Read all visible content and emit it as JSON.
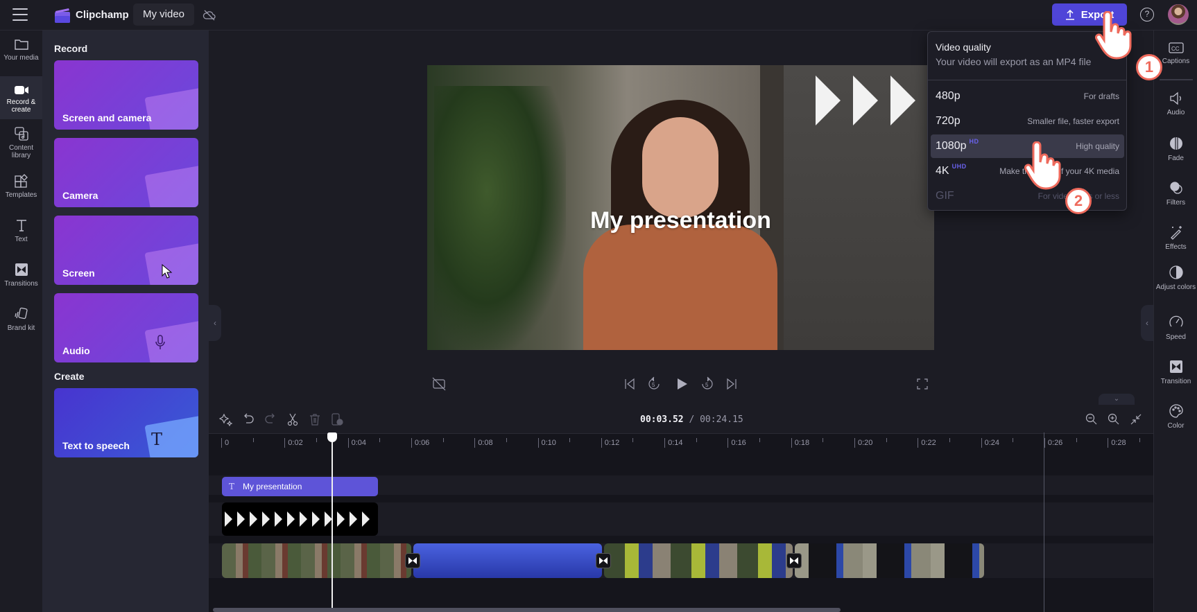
{
  "app": {
    "brand": "Clipchamp",
    "project_name": "My video",
    "export_label": "Export",
    "help_label": "?"
  },
  "colors": {
    "accent": "#4f45d8",
    "annotation": "#ee6a5c",
    "badge": "#6a62ee"
  },
  "left_nav": [
    {
      "label": "Your media",
      "icon": "folder-icon"
    },
    {
      "label": "Record & create",
      "icon": "video-camera-icon",
      "active": true
    },
    {
      "label": "Content library",
      "icon": "content-library-icon"
    },
    {
      "label": "Templates",
      "icon": "templates-icon"
    },
    {
      "label": "Text",
      "icon": "text-icon"
    },
    {
      "label": "Transitions",
      "icon": "transitions-icon"
    },
    {
      "label": "Brand kit",
      "icon": "brand-kit-icon"
    }
  ],
  "panel": {
    "record_heading": "Record",
    "create_heading": "Create",
    "record_cards": [
      {
        "label": "Screen and camera"
      },
      {
        "label": "Camera"
      },
      {
        "label": "Screen"
      },
      {
        "label": "Audio"
      }
    ],
    "create_cards": [
      {
        "label": "Text to speech"
      }
    ]
  },
  "preview": {
    "overlay_title": "My presentation"
  },
  "export_menu": {
    "title": "Video quality",
    "subtitle": "Your video will export as an MP4 file",
    "options": [
      {
        "quality": "480p",
        "badge": "",
        "description": "For drafts",
        "state": "normal"
      },
      {
        "quality": "720p",
        "badge": "",
        "description": "Smaller file, faster export",
        "state": "normal"
      },
      {
        "quality": "1080p",
        "badge": "HD",
        "description": "High quality",
        "state": "hover"
      },
      {
        "quality": "4K",
        "badge": "UHD",
        "description": "Make the most of your 4K media",
        "state": "normal"
      },
      {
        "quality": "GIF",
        "badge": "",
        "description": "For videos 15s or less",
        "state": "disabled"
      }
    ]
  },
  "annotations": {
    "step1": "1",
    "step2": "2"
  },
  "right_nav": [
    {
      "label": "Captions",
      "icon": "captions-icon"
    },
    {
      "label": "Audio",
      "icon": "speaker-icon"
    },
    {
      "label": "Fade",
      "icon": "fade-icon"
    },
    {
      "label": "Filters",
      "icon": "filters-icon"
    },
    {
      "label": "Effects",
      "icon": "magic-wand-icon"
    },
    {
      "label": "Adjust colors",
      "icon": "contrast-icon"
    },
    {
      "label": "Speed",
      "icon": "speedometer-icon"
    },
    {
      "label": "Transition",
      "icon": "transition-icon"
    },
    {
      "label": "Color",
      "icon": "palette-icon"
    }
  ],
  "timeline": {
    "current_time": "00:03.52",
    "total_time": "/ 00:24.15",
    "ruler_labels": [
      "0",
      "0:02",
      "0:04",
      "0:06",
      "0:08",
      "0:10",
      "0:12",
      "0:14",
      "0:16",
      "0:18",
      "0:20",
      "0:22",
      "0:24",
      "0:26",
      "0:28"
    ],
    "text_clip_label": "My presentation",
    "text_clip_icon": "T"
  }
}
